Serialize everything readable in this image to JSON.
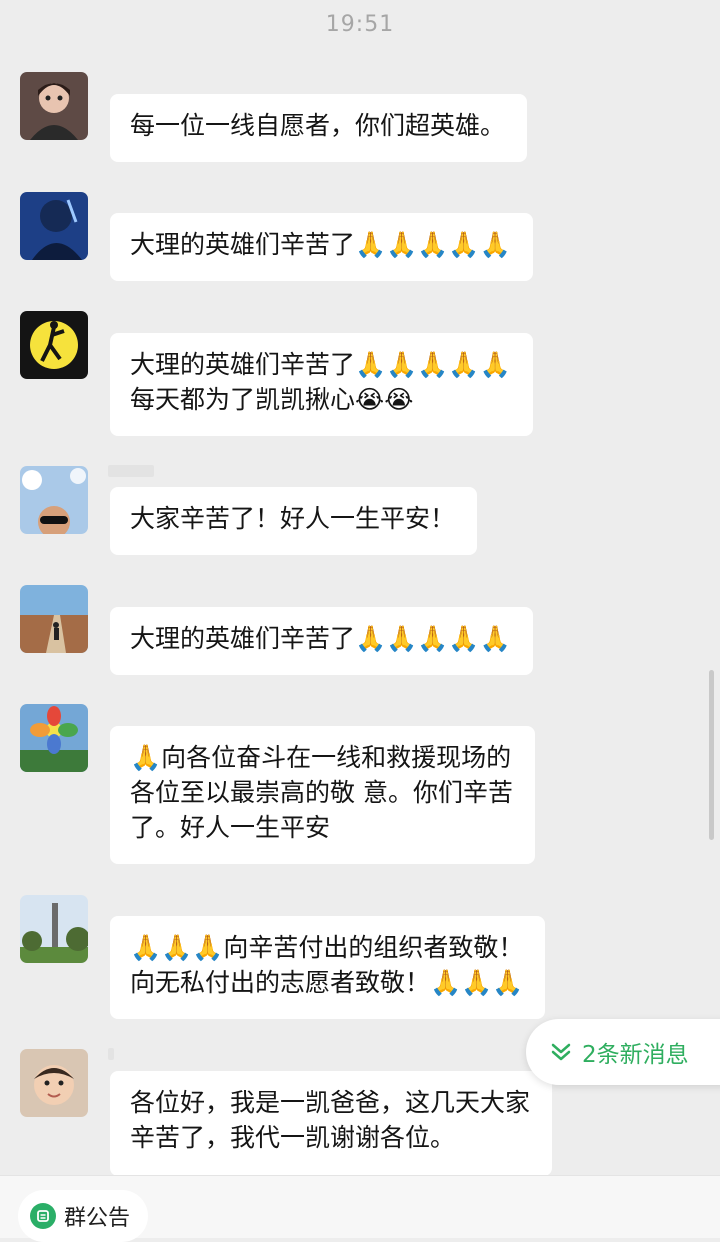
{
  "status": {
    "time": "19:51"
  },
  "messages": [
    {
      "text": "每一位一线自愿者，你们超英雄。"
    },
    {
      "text": "大理的英雄们辛苦了🙏🙏🙏🙏🙏"
    },
    {
      "text": "大理的英雄们辛苦了🙏🙏🙏🙏🙏\n每天都为了凯凯揪心😭😭"
    },
    {
      "text": "大家辛苦了！好人一生平安！"
    },
    {
      "text": "大理的英雄们辛苦了🙏🙏🙏🙏🙏"
    },
    {
      "text": "🙏向各位奋斗在一线和救援现场的\n各位至以最崇高的敬 意。你们辛苦\n了。好人一生平安"
    },
    {
      "text": "🙏🙏🙏向辛苦付出的组织者致敬！\n向无私付出的志愿者致敬！🙏🙏🙏"
    },
    {
      "text": "各位好，我是一凯爸爸，这几天大家\n辛苦了，我代一凯谢谢各位。"
    }
  ],
  "new_messages": {
    "label": "2条新消息"
  },
  "bottom": {
    "notice_label": "群公告"
  },
  "colors": {
    "accent": "#2aae67",
    "bubble": "#ffffff",
    "background": "#ededed"
  }
}
